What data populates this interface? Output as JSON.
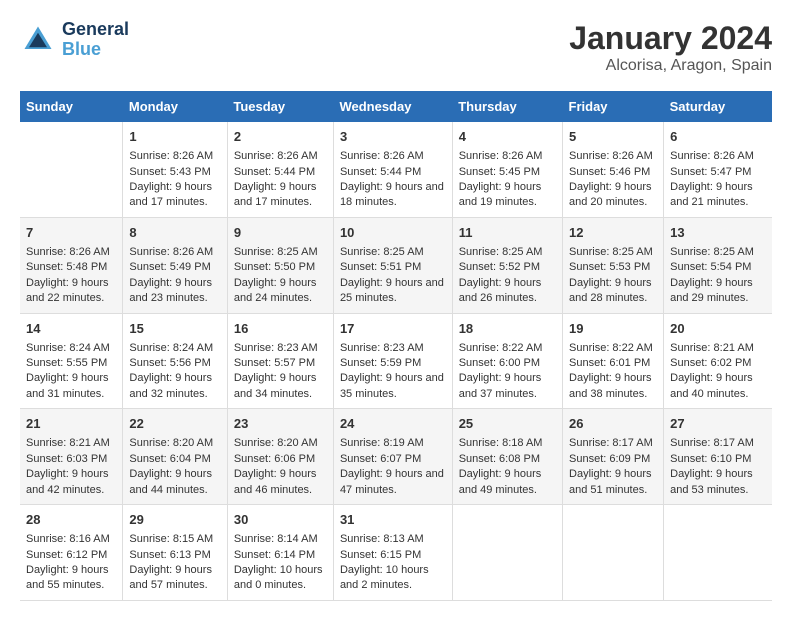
{
  "logo": {
    "line1": "General",
    "line2": "Blue"
  },
  "title": "January 2024",
  "subtitle": "Alcorisa, Aragon, Spain",
  "weekdays": [
    "Sunday",
    "Monday",
    "Tuesday",
    "Wednesday",
    "Thursday",
    "Friday",
    "Saturday"
  ],
  "weeks": [
    [
      {
        "day": "",
        "sunrise": "",
        "sunset": "",
        "daylight": ""
      },
      {
        "day": "1",
        "sunrise": "Sunrise: 8:26 AM",
        "sunset": "Sunset: 5:43 PM",
        "daylight": "Daylight: 9 hours and 17 minutes."
      },
      {
        "day": "2",
        "sunrise": "Sunrise: 8:26 AM",
        "sunset": "Sunset: 5:44 PM",
        "daylight": "Daylight: 9 hours and 17 minutes."
      },
      {
        "day": "3",
        "sunrise": "Sunrise: 8:26 AM",
        "sunset": "Sunset: 5:44 PM",
        "daylight": "Daylight: 9 hours and 18 minutes."
      },
      {
        "day": "4",
        "sunrise": "Sunrise: 8:26 AM",
        "sunset": "Sunset: 5:45 PM",
        "daylight": "Daylight: 9 hours and 19 minutes."
      },
      {
        "day": "5",
        "sunrise": "Sunrise: 8:26 AM",
        "sunset": "Sunset: 5:46 PM",
        "daylight": "Daylight: 9 hours and 20 minutes."
      },
      {
        "day": "6",
        "sunrise": "Sunrise: 8:26 AM",
        "sunset": "Sunset: 5:47 PM",
        "daylight": "Daylight: 9 hours and 21 minutes."
      }
    ],
    [
      {
        "day": "7",
        "sunrise": "Sunrise: 8:26 AM",
        "sunset": "Sunset: 5:48 PM",
        "daylight": "Daylight: 9 hours and 22 minutes."
      },
      {
        "day": "8",
        "sunrise": "Sunrise: 8:26 AM",
        "sunset": "Sunset: 5:49 PM",
        "daylight": "Daylight: 9 hours and 23 minutes."
      },
      {
        "day": "9",
        "sunrise": "Sunrise: 8:25 AM",
        "sunset": "Sunset: 5:50 PM",
        "daylight": "Daylight: 9 hours and 24 minutes."
      },
      {
        "day": "10",
        "sunrise": "Sunrise: 8:25 AM",
        "sunset": "Sunset: 5:51 PM",
        "daylight": "Daylight: 9 hours and 25 minutes."
      },
      {
        "day": "11",
        "sunrise": "Sunrise: 8:25 AM",
        "sunset": "Sunset: 5:52 PM",
        "daylight": "Daylight: 9 hours and 26 minutes."
      },
      {
        "day": "12",
        "sunrise": "Sunrise: 8:25 AM",
        "sunset": "Sunset: 5:53 PM",
        "daylight": "Daylight: 9 hours and 28 minutes."
      },
      {
        "day": "13",
        "sunrise": "Sunrise: 8:25 AM",
        "sunset": "Sunset: 5:54 PM",
        "daylight": "Daylight: 9 hours and 29 minutes."
      }
    ],
    [
      {
        "day": "14",
        "sunrise": "Sunrise: 8:24 AM",
        "sunset": "Sunset: 5:55 PM",
        "daylight": "Daylight: 9 hours and 31 minutes."
      },
      {
        "day": "15",
        "sunrise": "Sunrise: 8:24 AM",
        "sunset": "Sunset: 5:56 PM",
        "daylight": "Daylight: 9 hours and 32 minutes."
      },
      {
        "day": "16",
        "sunrise": "Sunrise: 8:23 AM",
        "sunset": "Sunset: 5:57 PM",
        "daylight": "Daylight: 9 hours and 34 minutes."
      },
      {
        "day": "17",
        "sunrise": "Sunrise: 8:23 AM",
        "sunset": "Sunset: 5:59 PM",
        "daylight": "Daylight: 9 hours and 35 minutes."
      },
      {
        "day": "18",
        "sunrise": "Sunrise: 8:22 AM",
        "sunset": "Sunset: 6:00 PM",
        "daylight": "Daylight: 9 hours and 37 minutes."
      },
      {
        "day": "19",
        "sunrise": "Sunrise: 8:22 AM",
        "sunset": "Sunset: 6:01 PM",
        "daylight": "Daylight: 9 hours and 38 minutes."
      },
      {
        "day": "20",
        "sunrise": "Sunrise: 8:21 AM",
        "sunset": "Sunset: 6:02 PM",
        "daylight": "Daylight: 9 hours and 40 minutes."
      }
    ],
    [
      {
        "day": "21",
        "sunrise": "Sunrise: 8:21 AM",
        "sunset": "Sunset: 6:03 PM",
        "daylight": "Daylight: 9 hours and 42 minutes."
      },
      {
        "day": "22",
        "sunrise": "Sunrise: 8:20 AM",
        "sunset": "Sunset: 6:04 PM",
        "daylight": "Daylight: 9 hours and 44 minutes."
      },
      {
        "day": "23",
        "sunrise": "Sunrise: 8:20 AM",
        "sunset": "Sunset: 6:06 PM",
        "daylight": "Daylight: 9 hours and 46 minutes."
      },
      {
        "day": "24",
        "sunrise": "Sunrise: 8:19 AM",
        "sunset": "Sunset: 6:07 PM",
        "daylight": "Daylight: 9 hours and 47 minutes."
      },
      {
        "day": "25",
        "sunrise": "Sunrise: 8:18 AM",
        "sunset": "Sunset: 6:08 PM",
        "daylight": "Daylight: 9 hours and 49 minutes."
      },
      {
        "day": "26",
        "sunrise": "Sunrise: 8:17 AM",
        "sunset": "Sunset: 6:09 PM",
        "daylight": "Daylight: 9 hours and 51 minutes."
      },
      {
        "day": "27",
        "sunrise": "Sunrise: 8:17 AM",
        "sunset": "Sunset: 6:10 PM",
        "daylight": "Daylight: 9 hours and 53 minutes."
      }
    ],
    [
      {
        "day": "28",
        "sunrise": "Sunrise: 8:16 AM",
        "sunset": "Sunset: 6:12 PM",
        "daylight": "Daylight: 9 hours and 55 minutes."
      },
      {
        "day": "29",
        "sunrise": "Sunrise: 8:15 AM",
        "sunset": "Sunset: 6:13 PM",
        "daylight": "Daylight: 9 hours and 57 minutes."
      },
      {
        "day": "30",
        "sunrise": "Sunrise: 8:14 AM",
        "sunset": "Sunset: 6:14 PM",
        "daylight": "Daylight: 10 hours and 0 minutes."
      },
      {
        "day": "31",
        "sunrise": "Sunrise: 8:13 AM",
        "sunset": "Sunset: 6:15 PM",
        "daylight": "Daylight: 10 hours and 2 minutes."
      },
      {
        "day": "",
        "sunrise": "",
        "sunset": "",
        "daylight": ""
      },
      {
        "day": "",
        "sunrise": "",
        "sunset": "",
        "daylight": ""
      },
      {
        "day": "",
        "sunrise": "",
        "sunset": "",
        "daylight": ""
      }
    ]
  ]
}
